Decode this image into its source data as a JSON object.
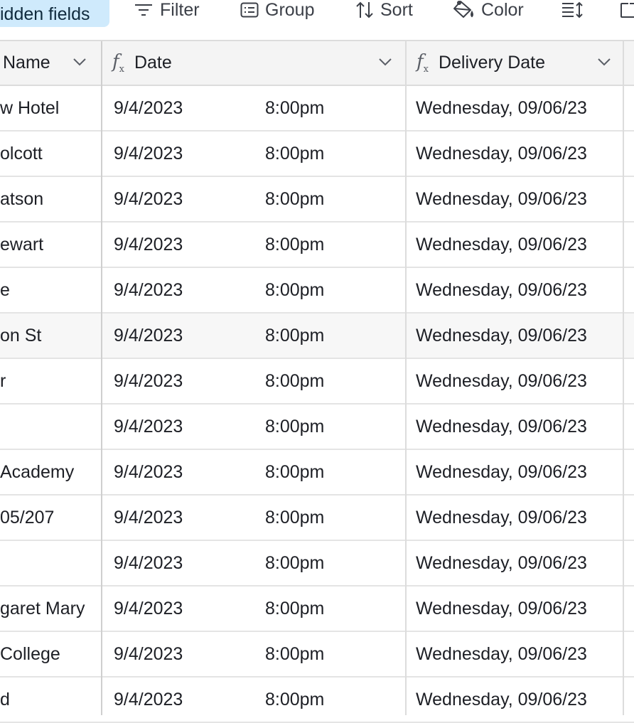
{
  "toolbar": {
    "hidden_fields_label": "idden fields",
    "filter_label": "Filter",
    "group_label": "Group",
    "sort_label": "Sort",
    "color_label": "Color"
  },
  "columns": {
    "name": "Name",
    "date": "Date",
    "delivery_date": "Delivery Date"
  },
  "rows": [
    {
      "name": "w Hotel",
      "date": "9/4/2023",
      "time": "8:00pm",
      "delivery": "Wednesday, 09/06/23"
    },
    {
      "name": "olcott",
      "date": "9/4/2023",
      "time": "8:00pm",
      "delivery": "Wednesday, 09/06/23"
    },
    {
      "name": "atson",
      "date": "9/4/2023",
      "time": "8:00pm",
      "delivery": "Wednesday, 09/06/23"
    },
    {
      "name": "ewart",
      "date": "9/4/2023",
      "time": "8:00pm",
      "delivery": "Wednesday, 09/06/23"
    },
    {
      "name": "e",
      "date": "9/4/2023",
      "time": "8:00pm",
      "delivery": "Wednesday, 09/06/23"
    },
    {
      "name": "on St",
      "date": "9/4/2023",
      "time": "8:00pm",
      "delivery": "Wednesday, 09/06/23"
    },
    {
      "name": "r",
      "date": "9/4/2023",
      "time": "8:00pm",
      "delivery": "Wednesday, 09/06/23"
    },
    {
      "name": "",
      "date": "9/4/2023",
      "time": "8:00pm",
      "delivery": "Wednesday, 09/06/23"
    },
    {
      "name": "Academy",
      "date": "9/4/2023",
      "time": "8:00pm",
      "delivery": "Wednesday, 09/06/23"
    },
    {
      "name": "05/207",
      "date": "9/4/2023",
      "time": "8:00pm",
      "delivery": "Wednesday, 09/06/23"
    },
    {
      "name": "",
      "date": "9/4/2023",
      "time": "8:00pm",
      "delivery": "Wednesday, 09/06/23"
    },
    {
      "name": "garet Mary",
      "date": "9/4/2023",
      "time": "8:00pm",
      "delivery": "Wednesday, 09/06/23"
    },
    {
      "name": "College",
      "date": "9/4/2023",
      "time": "8:00pm",
      "delivery": "Wednesday, 09/06/23"
    },
    {
      "name": "d",
      "date": "9/4/2023",
      "time": "8:00pm",
      "delivery": "Wednesday, 09/06/23"
    }
  ],
  "highlighted_row": 5,
  "colors": {
    "pill_bg": "#cfeafc",
    "header_bg": "#f4f4f4",
    "border": "#dcdcdc",
    "hover_row": "#f7f7f7",
    "text": "#1d1f25"
  }
}
